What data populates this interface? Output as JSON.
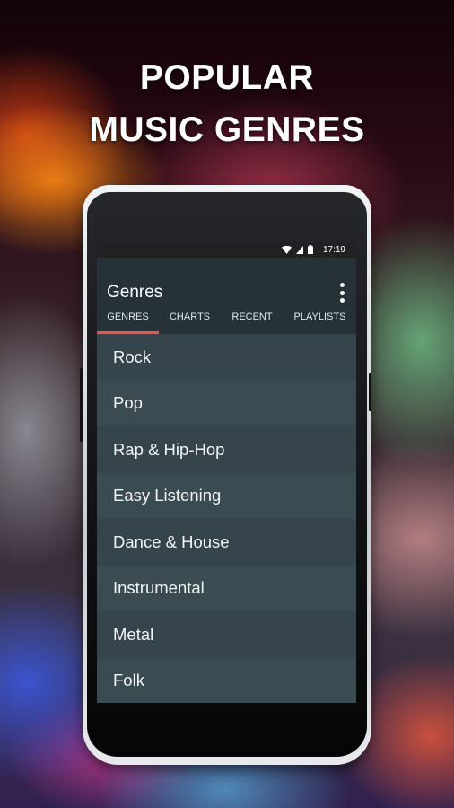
{
  "promo": {
    "headline_line1": "POPULAR",
    "headline_line2": "MUSIC GENRES"
  },
  "status_bar": {
    "icons": [
      "wifi-icon",
      "signal-icon",
      "battery-icon"
    ],
    "time": "17:19"
  },
  "app_bar": {
    "title": "Genres",
    "menu_icon": "more-vert-icon"
  },
  "tabs": [
    {
      "label": "GENRES",
      "active": true
    },
    {
      "label": "CHARTS",
      "active": false
    },
    {
      "label": "RECENT",
      "active": false
    },
    {
      "label": "PLAYLISTS",
      "active": false
    }
  ],
  "genres": [
    "Rock",
    "Pop",
    "Rap & Hip-Hop",
    "Easy Listening",
    "Dance & House",
    "Instrumental",
    "Metal",
    "Folk"
  ],
  "colors": {
    "app_bar": "#263238",
    "list_bg": "#37474f",
    "tab_indicator": "#ef5350",
    "status_bar": "#1f2123"
  }
}
